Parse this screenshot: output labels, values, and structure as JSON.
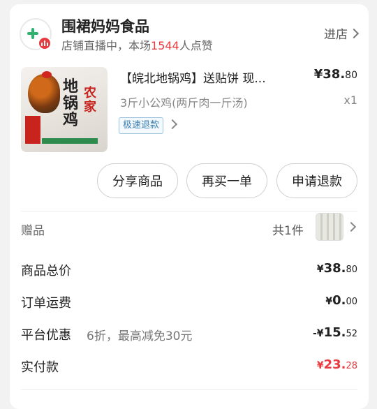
{
  "store": {
    "name": "围裙妈妈食品",
    "live_prefix": "店铺直播中，本场",
    "live_count": "1544",
    "live_suffix": "人点赞",
    "enter_label": "进店"
  },
  "product": {
    "title": "【皖北地锅鸡】送贴饼  现...",
    "price_main": "¥38.",
    "price_cents": "80",
    "spec": "3斤小公鸡(两斤肉一斤汤)",
    "quantity": "x1",
    "refund_tag": "极速退款",
    "image_text_1": "地锅鸡",
    "image_text_2": "农家"
  },
  "actions": {
    "share": "分享商品",
    "rebuy": "再买一单",
    "refund": "申请退款"
  },
  "gift": {
    "label": "赠品",
    "count": "共1件"
  },
  "summary": {
    "total": {
      "label": "商品总价",
      "yen": "¥",
      "main": "38.",
      "cents": "80"
    },
    "shipping": {
      "label": "订单运费",
      "yen": "¥",
      "main": "0.",
      "cents": "00"
    },
    "discount": {
      "label": "平台优惠",
      "detail": "6折，最高减免30元",
      "yen": "-¥",
      "main": "15.",
      "cents": "52"
    },
    "paid": {
      "label": "实付款",
      "yen": "¥",
      "main": "23.",
      "cents": "28"
    }
  },
  "colors": {
    "accent_red": "#e83a3f",
    "brand_green": "#2db36f",
    "refund_blue": "#3c7fb4"
  }
}
